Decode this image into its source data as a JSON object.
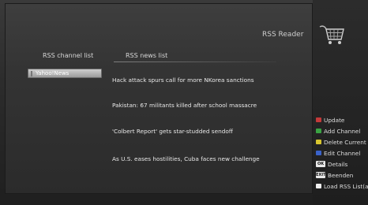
{
  "header": {
    "title": "RSS Reader"
  },
  "logo": {
    "icon": "shopping-cart-icon"
  },
  "channels": {
    "heading": "RSS channel list",
    "items": [
      {
        "label": "Yahoo!News"
      }
    ]
  },
  "news": {
    "heading": "RSS news list",
    "items": [
      {
        "title": "Hack attack spurs call for more NKorea sanctions"
      },
      {
        "title": "Pakistan: 67 militants killed after school massacre"
      },
      {
        "title": "'Colbert Report' gets star-studded sendoff"
      },
      {
        "title": "As U.S. eases hostilities, Cuba faces new challenge"
      }
    ]
  },
  "menu": {
    "items": [
      {
        "key": "red",
        "label": "Update"
      },
      {
        "key": "green",
        "label": "Add Channel"
      },
      {
        "key": "yellow",
        "label": "Delete Current"
      },
      {
        "key": "blue",
        "label": "Edit Channel"
      },
      {
        "key": "OK",
        "label": "Details"
      },
      {
        "key": "EXIT",
        "label": "Beenden"
      },
      {
        "key": "white",
        "label": "Load RSS List(a"
      }
    ]
  },
  "colors": {
    "red": "#c43a3a",
    "green": "#3aa343",
    "yellow": "#d7c52f",
    "blue": "#3a62c9",
    "selection": "#b0b0b0"
  }
}
